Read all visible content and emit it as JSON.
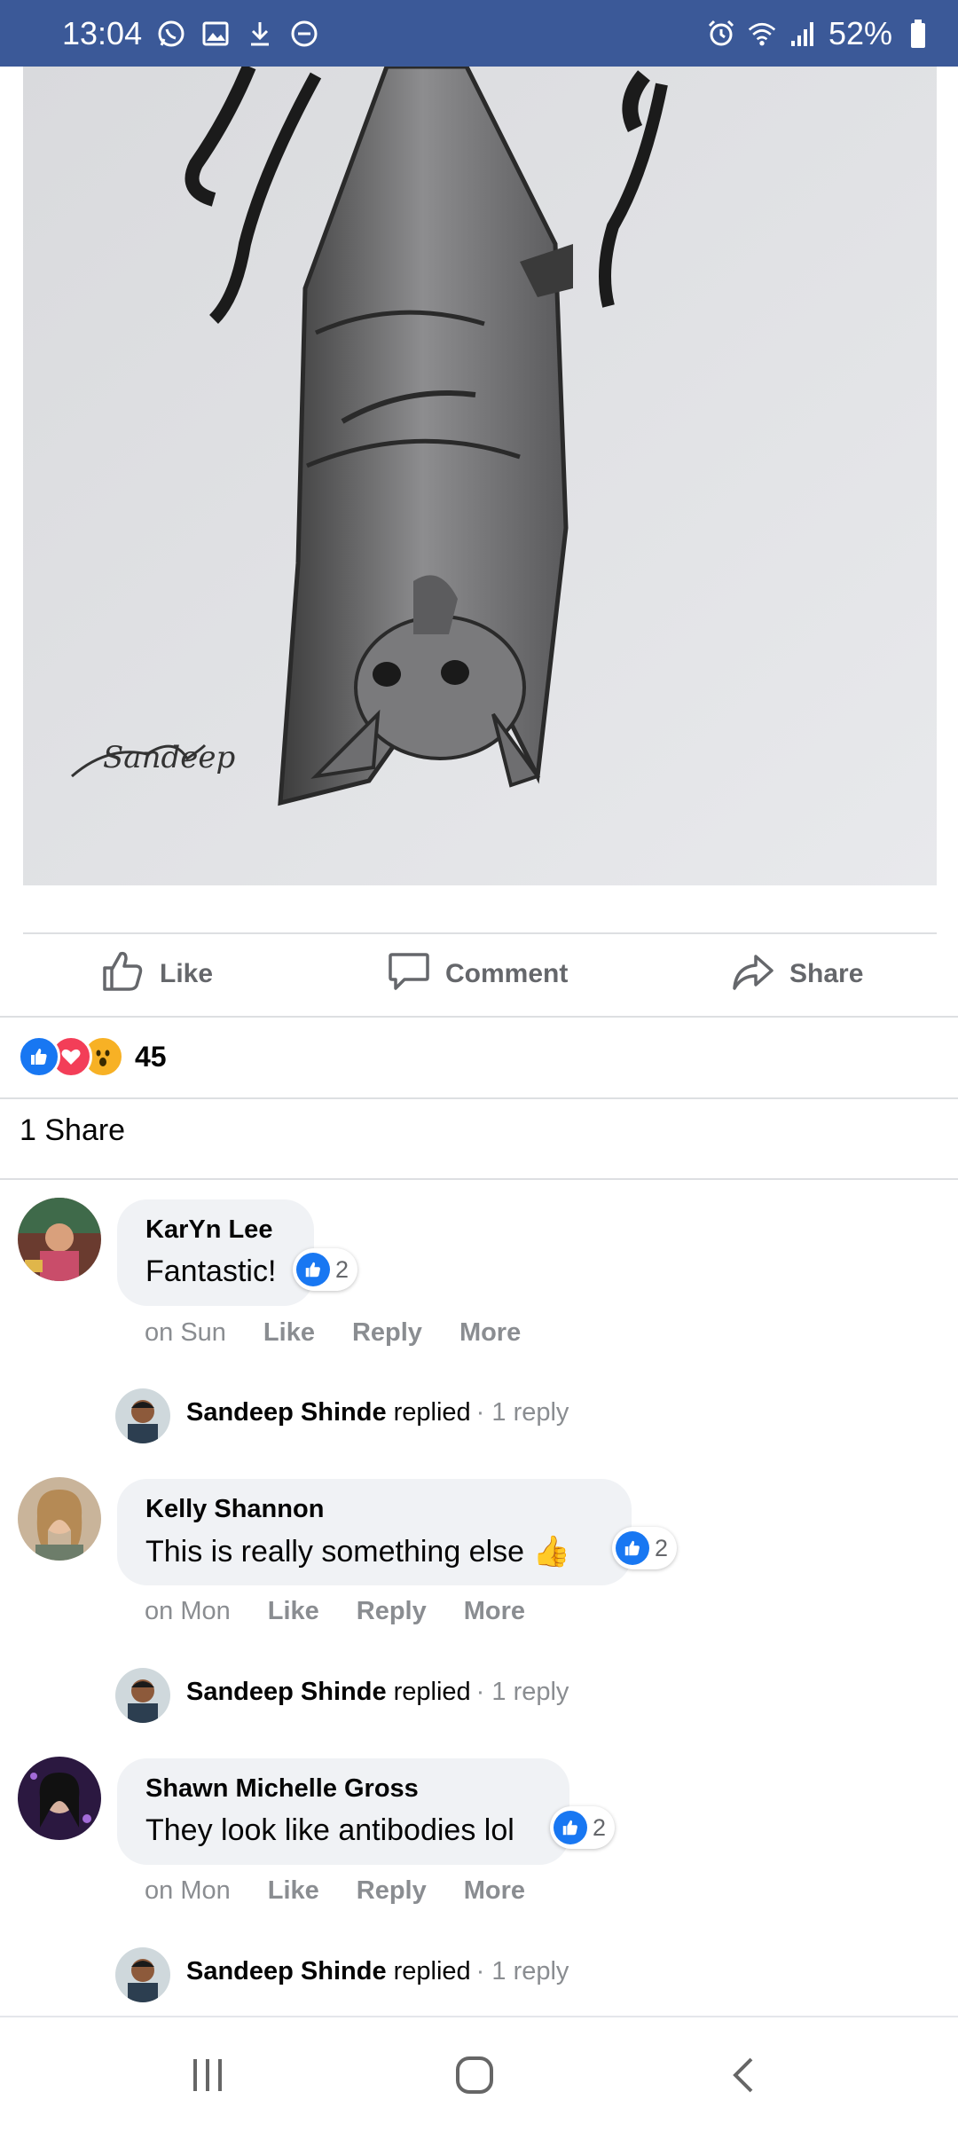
{
  "status_bar": {
    "time": "13:04",
    "battery": "52%",
    "icons_left": [
      "whatsapp-icon",
      "gallery-icon",
      "download-icon",
      "dnd-icon"
    ],
    "icons_right": [
      "alarm-icon",
      "wifi-icon",
      "signal-icon",
      "battery-icon"
    ]
  },
  "post": {
    "image_alt": "Hanging bat drawing",
    "signature": "Sandeep"
  },
  "actions": {
    "like": "Like",
    "comment": "Comment",
    "share": "Share"
  },
  "reactions": {
    "types": [
      "like",
      "love",
      "wow"
    ],
    "count": "45"
  },
  "shares_text": "1 Share",
  "comments": [
    {
      "author": "KarYn Lee",
      "text": "Fantastic!",
      "reaction_count": "2",
      "time": "on Sun",
      "like": "Like",
      "reply": "Reply",
      "more": "More",
      "replier": "Sandeep Shinde",
      "replied_word": "replied",
      "reply_count": "· 1 reply"
    },
    {
      "author": "Kelly Shannon",
      "text": "This is really something else 👍",
      "reaction_count": "2",
      "time": "on Mon",
      "like": "Like",
      "reply": "Reply",
      "more": "More",
      "replier": "Sandeep Shinde",
      "replied_word": "replied",
      "reply_count": "· 1 reply"
    },
    {
      "author": "Shawn Michelle Gross",
      "text": "They look like antibodies lol",
      "reaction_count": "2",
      "time": "on Mon",
      "like": "Like",
      "reply": "Reply",
      "more": "More",
      "replier": "Sandeep Shinde",
      "replied_word": "replied",
      "reply_count": "· 1 reply"
    }
  ],
  "colors": {
    "status_bar": "#3b5998",
    "facebook_blue": "#1877f2",
    "love_red": "#f33e58",
    "wow_yellow": "#f7b125",
    "muted": "#65676b"
  }
}
